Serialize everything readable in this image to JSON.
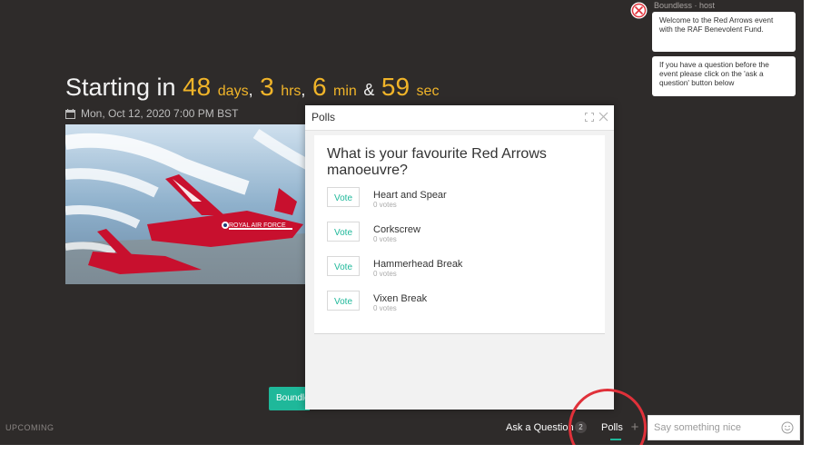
{
  "hero": {
    "prefix": "Starting in",
    "days_value": "48",
    "days_unit": "days",
    "hrs_value": "3",
    "hrs_unit": "hrs",
    "min_value": "6",
    "min_unit": "min",
    "amp": "&",
    "sec_value": "59",
    "sec_unit": "sec",
    "date": "Mon, Oct 12, 2020 7:00 PM BST",
    "photo_text": "ROYAL AIR FORCE"
  },
  "brand_button": "Boundless",
  "status": "UPCOMING",
  "bottom_bar": {
    "ask_question": "Ask a Question",
    "ask_count": "2",
    "polls": "Polls",
    "plus": "+",
    "chat_placeholder": "Say something nice"
  },
  "chat": {
    "host_name": "Boundless",
    "host_role": "host",
    "messages": [
      "Welcome to the Red Arrows event with the RAF Benevolent Fund.",
      "If you have a question before the event please click on the 'ask a question' button below"
    ]
  },
  "polls_modal": {
    "title": "Polls",
    "question": "What is your favourite Red Arrows manoeuvre?",
    "vote_label": "Vote",
    "options": [
      {
        "label": "Heart and Spear",
        "votes": "0 votes"
      },
      {
        "label": "Corkscrew",
        "votes": "0 votes"
      },
      {
        "label": "Hammerhead Break",
        "votes": "0 votes"
      },
      {
        "label": "Vixen Break",
        "votes": "0 votes"
      }
    ]
  },
  "colors": {
    "accent": "#1fb89a",
    "countdown": "#f0b429",
    "annotation": "#e0313a",
    "background": "#2e2b2a"
  }
}
